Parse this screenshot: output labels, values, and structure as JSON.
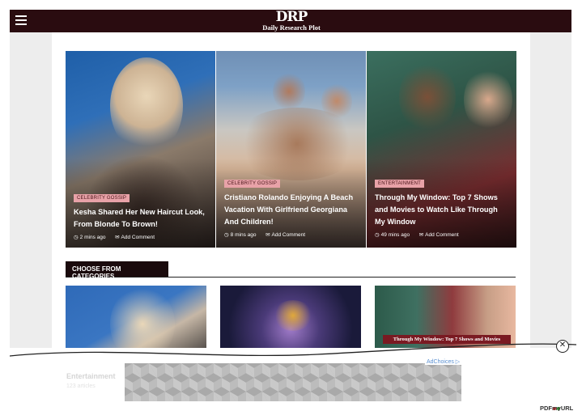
{
  "header": {
    "logo_mark": "DRP",
    "logo_tagline": "Daily Research Plot",
    "menu_icon": "hamburger-icon",
    "background_color": "#2a0c10"
  },
  "slider": [
    {
      "category": "CELEBRITY GOSSIP",
      "title": "Kesha Shared Her New Haircut Look, From Blonde To Brown!",
      "time": "2 mins ago",
      "comment": "Add Comment"
    },
    {
      "category": "CELEBRITY GOSSIP",
      "title": "Cristiano Rolando Enjoying A Beach Vacation With Girlfriend Georgiana And Children!",
      "time": "8 mins ago",
      "comment": "Add Comment"
    },
    {
      "category": "ENTERTAINMENT",
      "title": "Through My Window: Top 7 Shows and Movies to Watch Like Through My Window",
      "time": "49 mins ago",
      "comment": "Add Comment"
    }
  ],
  "categories_section": {
    "heading": "CHOOSE FROM CATEGORIES",
    "cards": [
      {
        "image_alt": "celebrity portrait"
      },
      {
        "image_alt": "space telescope"
      },
      {
        "banner_text": "Through My Window: Top 7 Shows and Movies"
      }
    ],
    "first_label": "Entertainment",
    "first_count": "123 articles"
  },
  "ad": {
    "adchoices_label": "AdChoices ▷",
    "close_symbol": "✕"
  },
  "watermark": {
    "text": "PDFmyURL"
  },
  "colors": {
    "accent_dark": "#1a0a0c",
    "badge_pink": "#e8a2a8"
  }
}
